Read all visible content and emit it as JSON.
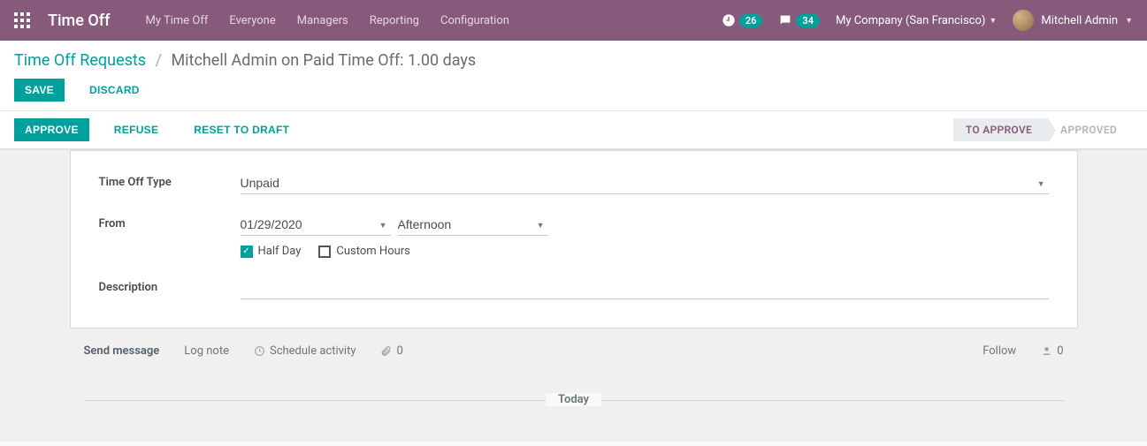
{
  "navbar": {
    "brand": "Time Off",
    "links": [
      "My Time Off",
      "Everyone",
      "Managers",
      "Reporting",
      "Configuration"
    ],
    "clock_badge": "26",
    "chat_badge": "34",
    "company": "My Company (San Francisco)",
    "user": "Mitchell Admin"
  },
  "breadcrumb": {
    "root": "Time Off Requests",
    "current": "Mitchell Admin on Paid Time Off: 1.00 days"
  },
  "buttons": {
    "save": "SAVE",
    "discard": "DISCARD",
    "approve": "APPROVE",
    "refuse": "REFUSE",
    "reset": "RESET TO DRAFT"
  },
  "status": {
    "to_approve": "TO APPROVE",
    "approved": "APPROVED"
  },
  "form": {
    "type_label": "Time Off Type",
    "type_value": "Unpaid",
    "from_label": "From",
    "date_value": "01/29/2020",
    "period_value": "Afternoon",
    "half_day_label": "Half Day",
    "custom_hours_label": "Custom Hours",
    "description_label": "Description",
    "description_value": ""
  },
  "chatter": {
    "send": "Send message",
    "log": "Log note",
    "schedule": "Schedule activity",
    "attach_count": "0",
    "follow": "Follow",
    "followers": "0",
    "today": "Today"
  }
}
